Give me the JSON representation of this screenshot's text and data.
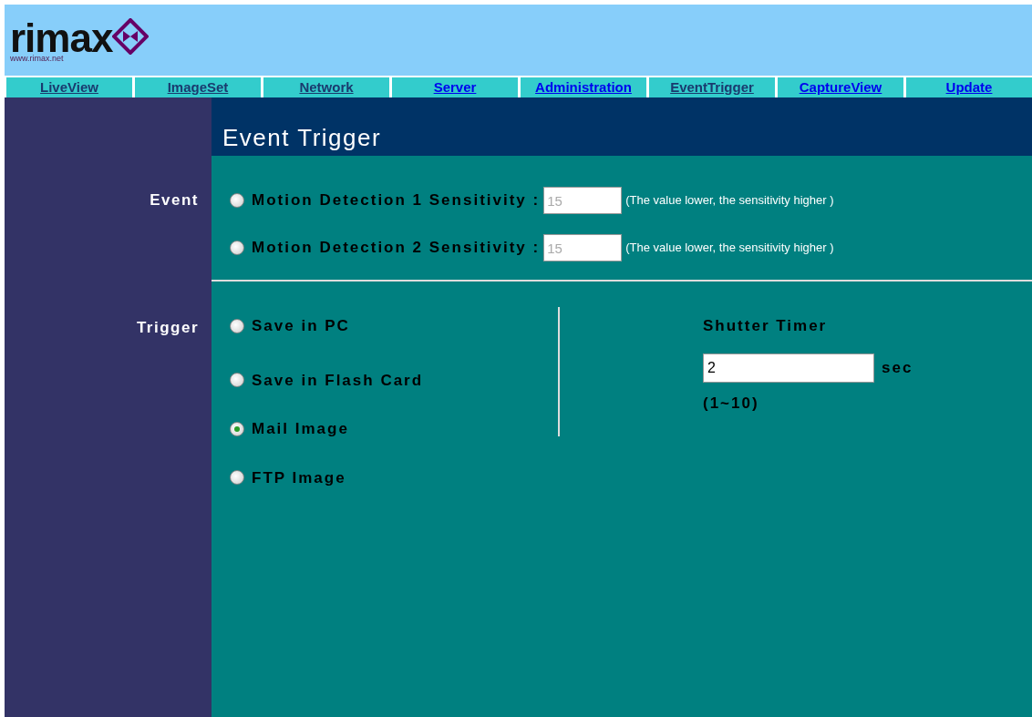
{
  "logo": {
    "name": "rimax",
    "url": "www.rimax.net"
  },
  "nav": [
    {
      "label": "LiveView",
      "visited": true
    },
    {
      "label": "ImageSet",
      "visited": true
    },
    {
      "label": "Network",
      "visited": true
    },
    {
      "label": "Server",
      "visited": false
    },
    {
      "label": "Administration",
      "visited": false
    },
    {
      "label": "EventTrigger",
      "visited": true
    },
    {
      "label": "CaptureView",
      "visited": false
    },
    {
      "label": "Update",
      "visited": false
    }
  ],
  "title": "Event Trigger",
  "event": {
    "label": "Event",
    "options": [
      {
        "label": "Motion Detection 1 Sensitivity :",
        "selected": false,
        "value": "15",
        "hint": "(The value lower, the sensitivity higher )"
      },
      {
        "label": "Motion Detection 2 Sensitivity :",
        "selected": false,
        "value": "15",
        "hint": "(The value lower, the sensitivity higher )"
      }
    ]
  },
  "trigger": {
    "label": "Trigger",
    "options": [
      {
        "label": "Save in PC",
        "selected": false
      },
      {
        "label": "Save in Flash Card",
        "selected": false
      },
      {
        "label": "Mail Image",
        "selected": true
      },
      {
        "label": "FTP Image",
        "selected": false
      }
    ],
    "shutter": {
      "label": "Shutter Timer",
      "value": "2",
      "unit": "sec",
      "range": "(1~10)"
    }
  }
}
